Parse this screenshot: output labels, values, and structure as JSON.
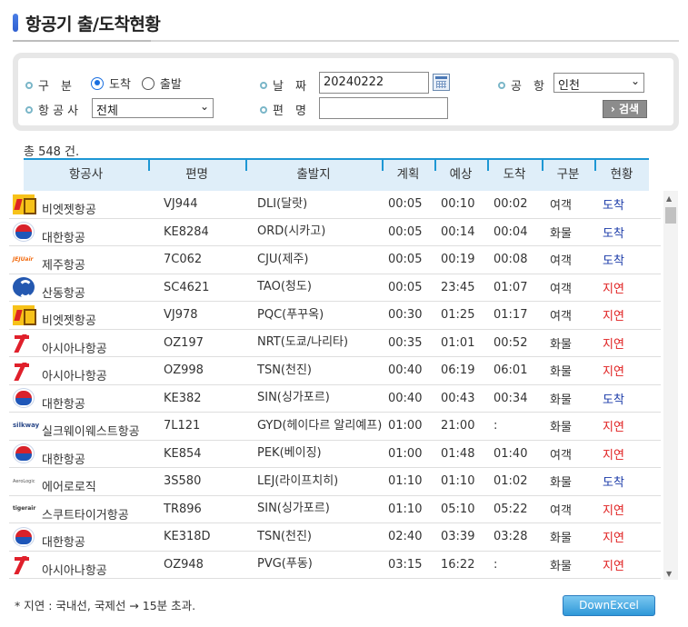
{
  "title": "항공기 출/도착현황",
  "search": {
    "type_label": "구　분",
    "type_options": [
      "도착",
      "출발"
    ],
    "type_selected": "도착",
    "airline_label": "항 공 사",
    "airline_value": "전체",
    "date_label": "날　짜",
    "date_value": "20240222",
    "flight_label": "편　명",
    "flight_value": "",
    "airport_label": "공　항",
    "airport_value": "인천",
    "search_button": "› 검색"
  },
  "count_text": "총 548 건.",
  "columns": [
    "항공사",
    "편명",
    "출발지",
    "계획",
    "예상",
    "도착",
    "구분",
    "현황"
  ],
  "rows": [
    {
      "logo": "vj",
      "airline": "비엣젯항공",
      "flight": "VJ944",
      "origin": "DLI(달랏)",
      "plan": "00:05",
      "est": "00:10",
      "arr": "00:02",
      "type": "여객",
      "status": "도착"
    },
    {
      "logo": "ke",
      "airline": "대한항공",
      "flight": "KE8284",
      "origin": "ORD(시카고)",
      "plan": "00:05",
      "est": "00:14",
      "arr": "00:04",
      "type": "화물",
      "status": "도착"
    },
    {
      "logo": "jeju",
      "airline": "제주항공",
      "flight": "7C062",
      "origin": "CJU(제주)",
      "plan": "00:05",
      "est": "00:19",
      "arr": "00:08",
      "type": "여객",
      "status": "도착"
    },
    {
      "logo": "sd",
      "airline": "산동항공",
      "flight": "SC4621",
      "origin": "TAO(청도)",
      "plan": "00:05",
      "est": "23:45",
      "arr": "01:07",
      "type": "여객",
      "status": "지연"
    },
    {
      "logo": "vj",
      "airline": "비엣젯항공",
      "flight": "VJ978",
      "origin": "PQC(푸꾸옥)",
      "plan": "00:30",
      "est": "01:25",
      "arr": "01:17",
      "type": "여객",
      "status": "지연"
    },
    {
      "logo": "oz",
      "airline": "아시아나항공",
      "flight": "OZ197",
      "origin": "NRT(도쿄/나리타)",
      "plan": "00:35",
      "est": "01:01",
      "arr": "00:52",
      "type": "화물",
      "status": "지연"
    },
    {
      "logo": "oz",
      "airline": "아시아나항공",
      "flight": "OZ998",
      "origin": "TSN(천진)",
      "plan": "00:40",
      "est": "06:19",
      "arr": "06:01",
      "type": "화물",
      "status": "지연"
    },
    {
      "logo": "ke",
      "airline": "대한항공",
      "flight": "KE382",
      "origin": "SIN(싱가포르)",
      "plan": "00:40",
      "est": "00:43",
      "arr": "00:34",
      "type": "화물",
      "status": "도착"
    },
    {
      "logo": "silk",
      "airline": "실크웨이웨스트항공",
      "flight": "7L121",
      "origin": "GYD(헤이다르 알리예프)",
      "plan": "01:00",
      "est": "21:00",
      "arr": ":",
      "type": "화물",
      "status": "지연"
    },
    {
      "logo": "ke",
      "airline": "대한항공",
      "flight": "KE854",
      "origin": "PEK(베이징)",
      "plan": "01:00",
      "est": "01:48",
      "arr": "01:40",
      "type": "여객",
      "status": "지연"
    },
    {
      "logo": "aero",
      "airline": "에어로로직",
      "flight": "3S580",
      "origin": "LEJ(라이프치히)",
      "plan": "01:10",
      "est": "01:10",
      "arr": "01:02",
      "type": "화물",
      "status": "도착"
    },
    {
      "logo": "tiger",
      "airline": "스쿠트타이거항공",
      "flight": "TR896",
      "origin": "SIN(싱가포르)",
      "plan": "01:10",
      "est": "05:10",
      "arr": "05:22",
      "type": "여객",
      "status": "지연"
    },
    {
      "logo": "ke",
      "airline": "대한항공",
      "flight": "KE318D",
      "origin": "TSN(천진)",
      "plan": "02:40",
      "est": "03:39",
      "arr": "03:28",
      "type": "화물",
      "status": "지연"
    },
    {
      "logo": "oz",
      "airline": "아시아나항공",
      "flight": "OZ948",
      "origin": "PVG(푸동)",
      "plan": "03:15",
      "est": "16:22",
      "arr": ":",
      "type": "화물",
      "status": "지연"
    }
  ],
  "note": "* 지연 : 국내선, 국제선 → 15분 초과.",
  "excel_button": "DownExcel",
  "colors": {
    "accent": "#1d97d4",
    "header_bg": "#dfeef9",
    "arrived": "#1a3aa8",
    "delayed": "#e02020"
  }
}
